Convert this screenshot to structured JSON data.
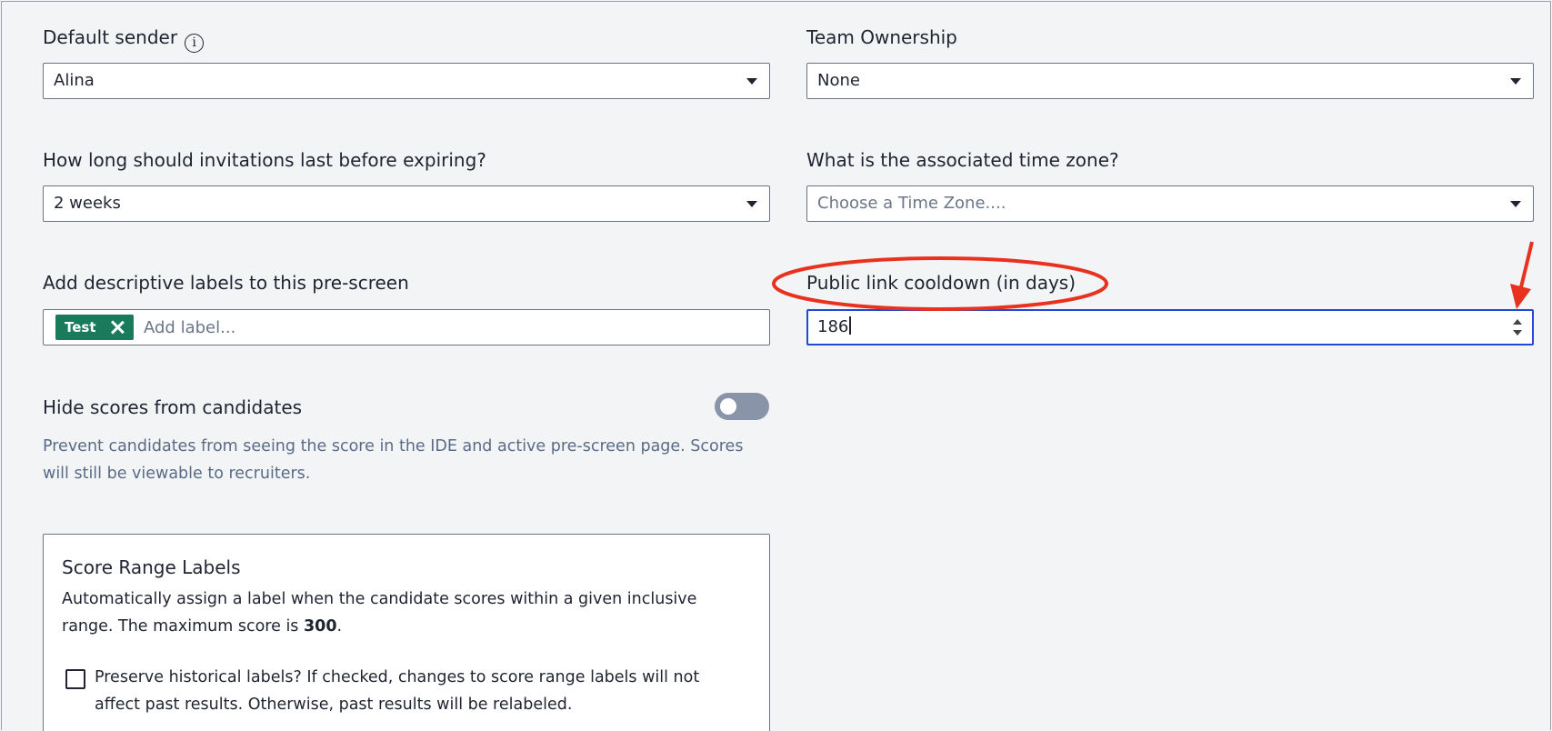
{
  "left": {
    "sender": {
      "label": "Default sender",
      "value": "Alina"
    },
    "expiry": {
      "label": "How long should invitations last before expiring?",
      "value": "2 weeks"
    },
    "labels": {
      "label": "Add descriptive labels to this pre-screen",
      "tags": [
        "Test"
      ],
      "placeholder": "Add label..."
    },
    "hide_scores": {
      "label": "Hide scores from candidates",
      "on": false,
      "help_line1": "Prevent candidates from seeing the score in the IDE and active pre-screen page. Scores",
      "help_line2": "will still be viewable to recruiters."
    },
    "score_range": {
      "title": "Score Range Labels",
      "desc_line1": "Automatically assign a label when the candidate scores within a given inclusive",
      "desc_pre": "range. The maximum score is ",
      "max_score": "300",
      "desc_post": ".",
      "checkbox_line1": "Preserve historical labels? If checked, changes to score range labels will not",
      "checkbox_line2": "affect past results. Otherwise, past results will be relabeled.",
      "checked": false
    }
  },
  "right": {
    "team": {
      "label": "Team Ownership",
      "value": "None"
    },
    "timezone": {
      "label": "What is the associated time zone?",
      "placeholder": "Choose a Time Zone...."
    },
    "cooldown": {
      "label": "Public link cooldown (in days)",
      "value": "186"
    }
  },
  "colors": {
    "annotation": "#e8321f",
    "tag_bg": "#1a7a5c",
    "focus_border": "#2448d6",
    "toggle_off": "#8a94a8"
  }
}
